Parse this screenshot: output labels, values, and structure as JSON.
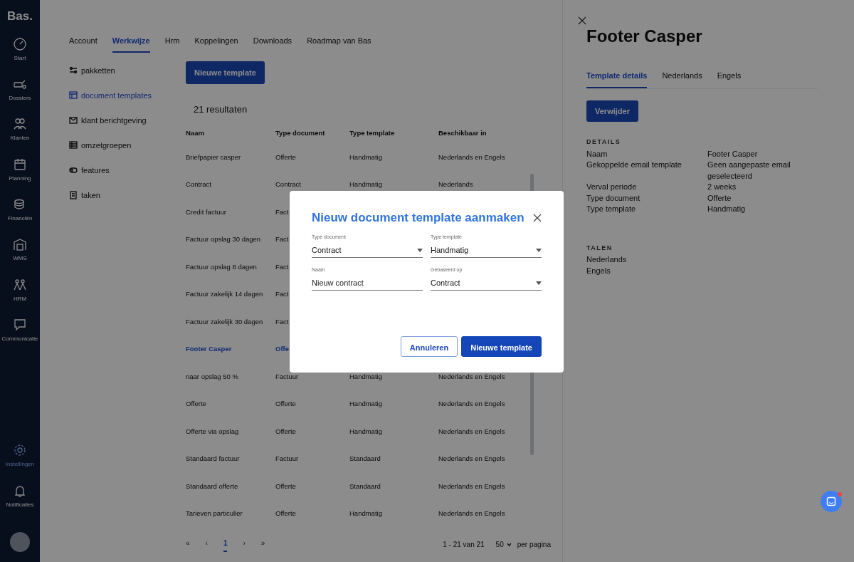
{
  "sidebar": {
    "logo": "Bas.",
    "items": [
      {
        "label": "Start",
        "selected": false
      },
      {
        "label": "Dossiers",
        "selected": false
      },
      {
        "label": "Klanten",
        "selected": false
      },
      {
        "label": "Planning",
        "selected": false
      },
      {
        "label": "Financiën",
        "selected": false
      },
      {
        "label": "WMS",
        "selected": false
      },
      {
        "label": "HRM",
        "selected": false
      },
      {
        "label": "Communicatie",
        "selected": false
      }
    ],
    "bottom_items": [
      {
        "label": "Instellingen",
        "selected": true
      },
      {
        "label": "Notificaties",
        "selected": false
      }
    ]
  },
  "tabs": [
    {
      "label": "Account",
      "selected": false
    },
    {
      "label": "Werkwijze",
      "selected": true
    },
    {
      "label": "Hrm",
      "selected": false
    },
    {
      "label": "Koppelingen",
      "selected": false
    },
    {
      "label": "Downloads",
      "selected": false
    },
    {
      "label": "Roadmap van Bas",
      "selected": false
    }
  ],
  "menu": [
    {
      "label": "pakketten",
      "selected": false
    },
    {
      "label": "document templates",
      "selected": true
    },
    {
      "label": "klant berichtgeving",
      "selected": false
    },
    {
      "label": "omzetgroepen",
      "selected": false
    },
    {
      "label": "features",
      "selected": false
    },
    {
      "label": "taken",
      "selected": false
    }
  ],
  "new_button": "Nieuwe template",
  "result_count": "21 resultaten",
  "table": {
    "columns": [
      "Naam",
      "Type document",
      "Type template",
      "Beschikbaar in"
    ],
    "rows": [
      {
        "cells": [
          "Briefpapier casper",
          "Offerte",
          "Handmatig",
          "Nederlands en Engels"
        ],
        "selected": false
      },
      {
        "cells": [
          "Contract",
          "Contract",
          "Handmatig",
          "Nederlands"
        ],
        "selected": false
      },
      {
        "cells": [
          "Credit factuur",
          "Fact"
        ],
        "selected": false
      },
      {
        "cells": [
          "Factuur opslag 30 dagen",
          "Fact"
        ],
        "selected": false
      },
      {
        "cells": [
          "Factuur opslag 8 dagen",
          "Fact"
        ],
        "selected": false
      },
      {
        "cells": [
          "Factuur zakelijk 14 dagen",
          "Fact"
        ],
        "selected": false
      },
      {
        "cells": [
          "Factuur zakelijk 30 dagen",
          "Fact"
        ],
        "selected": false
      },
      {
        "cells": [
          "Footer Casper",
          "Offe"
        ],
        "selected": true
      },
      {
        "cells": [
          "naar opslag 50 %",
          "Factuur",
          "Handmatig",
          "Nederlands en Engels"
        ],
        "selected": false
      },
      {
        "cells": [
          "Offerte",
          "Offerte",
          "Handmatig",
          "Nederlands en Engels"
        ],
        "selected": false
      },
      {
        "cells": [
          "Offerte via opslag",
          "Offerte",
          "Handmatig",
          "Nederlands en Engels"
        ],
        "selected": false
      },
      {
        "cells": [
          "Standaard factuur",
          "Factuur",
          "Standaard",
          "Nederlands en Engels"
        ],
        "selected": false
      },
      {
        "cells": [
          "Standaard offerte",
          "Offerte",
          "Standaard",
          "Nederlands en Engels"
        ],
        "selected": false
      },
      {
        "cells": [
          "Tarieven particulier",
          "Offerte",
          "Handmatig",
          "Nederlands en Engels"
        ],
        "selected": false
      }
    ]
  },
  "pagination": {
    "pages": [
      {
        "label": "«",
        "kind": "nav"
      },
      {
        "label": "‹",
        "kind": "nav"
      },
      {
        "label": "1",
        "kind": "page",
        "selected": true
      },
      {
        "label": "›",
        "kind": "nav"
      },
      {
        "label": "»",
        "kind": "nav"
      }
    ],
    "range": "1 - 21 van 21",
    "page_size": "50",
    "per_page_label": "per pagina"
  },
  "detail_panel": {
    "title": "Footer Casper",
    "tabs": [
      {
        "label": "Template details",
        "selected": true
      },
      {
        "label": "Nederlands",
        "selected": false
      },
      {
        "label": "Engels",
        "selected": false
      }
    ],
    "delete_button": "Verwijder",
    "details_heading": "DETAILS",
    "details": [
      {
        "label": "Naam",
        "value": "Footer Casper"
      },
      {
        "label": "Gekoppelde email template",
        "value": "Geen aangepaste email geselecteerd"
      },
      {
        "label": "Verval periode",
        "value": "2 weeks"
      },
      {
        "label": "Type document",
        "value": "Offerte"
      },
      {
        "label": "Type template",
        "value": "Handmatig"
      }
    ],
    "languages_heading": "TALEN",
    "languages": [
      "Nederlands",
      "Engels"
    ]
  },
  "modal": {
    "title": "Nieuw document template aanmaken",
    "fields": [
      {
        "kind": "select",
        "label": "Type document",
        "value": "Contract"
      },
      {
        "kind": "select",
        "label": "Type template",
        "value": "Handmatig"
      },
      {
        "kind": "text",
        "label": "Naam",
        "value": "Nieuw contract"
      },
      {
        "kind": "select",
        "label": "Gebaseerd op",
        "value": "Contract"
      }
    ],
    "buttons": [
      {
        "kind": "secondary",
        "label": "Annuleren"
      },
      {
        "kind": "primary",
        "label": "Nieuwe template"
      }
    ]
  }
}
